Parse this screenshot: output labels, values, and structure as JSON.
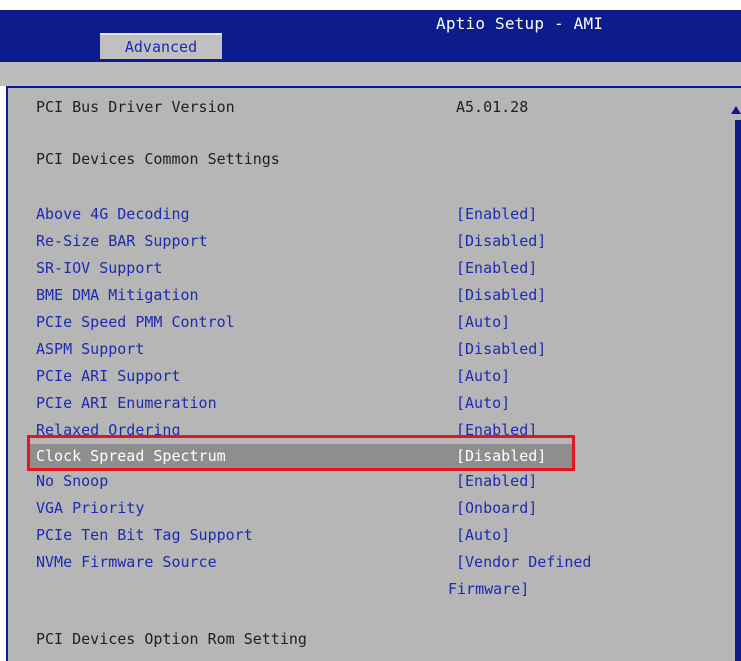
{
  "header": {
    "title": "Aptio Setup - AMI",
    "active_tab": "Advanced"
  },
  "info": {
    "driver_label": "PCI Bus Driver Version",
    "driver_value": "A5.01.28",
    "common_settings_heading": "PCI Devices Common Settings",
    "option_rom_heading": "PCI Devices Option Rom Setting"
  },
  "settings": [
    {
      "label": "Above 4G Decoding",
      "value": "[Enabled]"
    },
    {
      "label": "Re-Size BAR Support",
      "value": "[Disabled]"
    },
    {
      "label": "SR-IOV Support",
      "value": "[Enabled]"
    },
    {
      "label": "BME DMA Mitigation",
      "value": "[Disabled]"
    },
    {
      "label": "PCIe Speed PMM Control",
      "value": "[Auto]"
    },
    {
      "label": "ASPM Support",
      "value": "[Disabled]"
    },
    {
      "label": "PCIe ARI Support",
      "value": "[Auto]"
    },
    {
      "label": "PCIe ARI Enumeration",
      "value": "[Auto]"
    },
    {
      "label": "Relaxed Ordering",
      "value": "[Enabled]"
    },
    {
      "label": "Clock Spread Spectrum",
      "value": "[Disabled]",
      "selected": true
    },
    {
      "label": "No Snoop",
      "value": "[Enabled]"
    },
    {
      "label": "VGA Priority",
      "value": "[Onboard]"
    },
    {
      "label": "PCIe Ten Bit Tag Support",
      "value": "[Auto]"
    },
    {
      "label": "NVMe Firmware Source",
      "value": "[Vendor Defined",
      "value_line2": "Firmware]"
    }
  ],
  "colors": {
    "header_bg": "#0c1c8c",
    "panel_bg": "#b6b6b6",
    "option_text": "#1d2bb1",
    "highlight_border": "#e3161d",
    "selection_bg": "#8e8e8e"
  }
}
